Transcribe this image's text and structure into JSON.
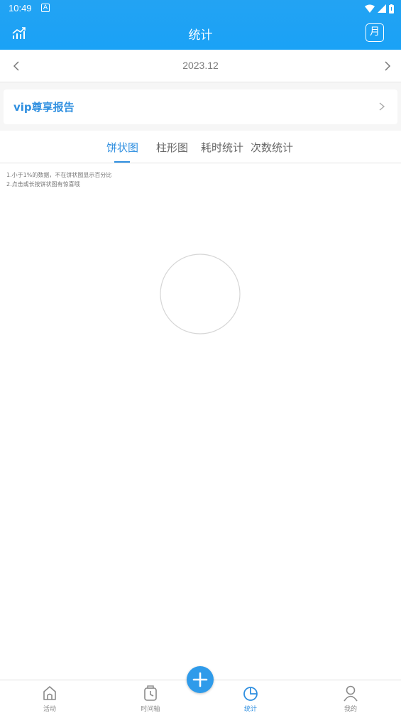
{
  "status_bar": {
    "time": "10:49",
    "notif_icon": "A"
  },
  "header": {
    "title": "统计",
    "left_icon": "trend-chart-icon",
    "right_button": "月"
  },
  "date_nav": {
    "label": "2023.12",
    "prev_icon": "chevron-left-icon",
    "next_icon": "chevron-right-icon"
  },
  "vip": {
    "label": "vip尊享报告"
  },
  "tabs": [
    {
      "label": "饼状图",
      "active": true
    },
    {
      "label": "柱形图",
      "active": false
    },
    {
      "label": "耗时统计",
      "active": false
    },
    {
      "label": "次数统计",
      "active": false
    }
  ],
  "notes": [
    "1.小于1%的数据，不在饼状图显示百分比",
    "2.点击或长按饼状图有惊喜哦"
  ],
  "bottom_nav": [
    {
      "label": "活动",
      "icon": "home-icon",
      "active": false
    },
    {
      "label": "时间轴",
      "icon": "clock-icon",
      "active": false
    },
    {
      "label": "统计",
      "icon": "pie-chart-icon",
      "active": true
    },
    {
      "label": "我的",
      "icon": "person-icon",
      "active": false
    }
  ],
  "colors": {
    "header": "#1aa2f6",
    "accent": "#2f8fe0",
    "fab": "#2f9bea"
  }
}
